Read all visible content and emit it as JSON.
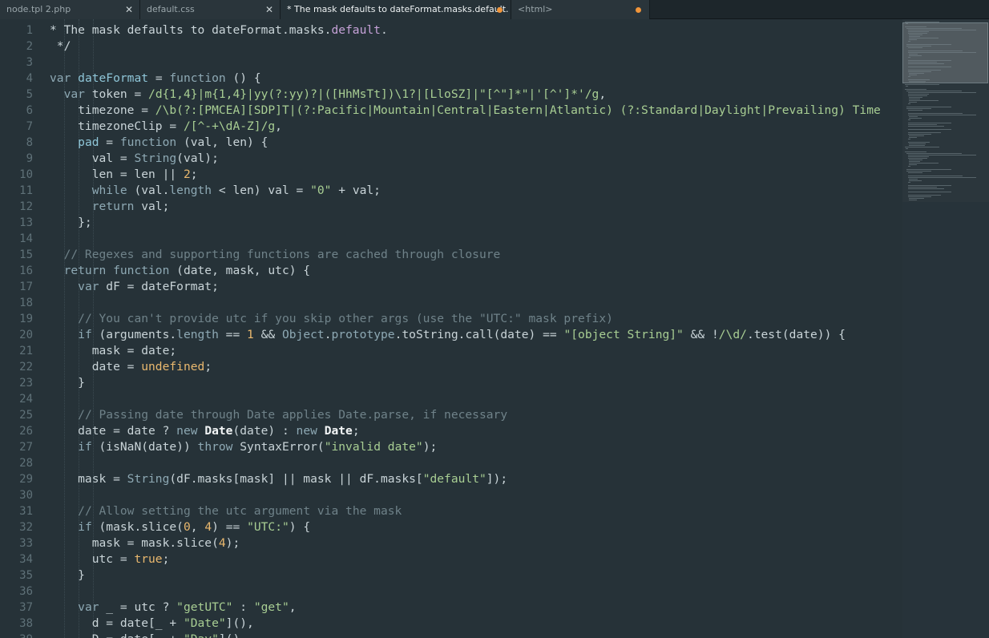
{
  "tabs": [
    {
      "label": "node.tpl 2.php",
      "state": "close"
    },
    {
      "label": "default.css",
      "state": "close"
    },
    {
      "label": "* The mask defaults to dateFormat.masks.default.",
      "state": "modified"
    },
    {
      "label": "<html>",
      "state": "modified"
    }
  ],
  "tab_close_glyph": "✕",
  "active_tab_index": 2,
  "colors": {
    "background": "#263238",
    "modified_dot": "#f0953a",
    "string": "#a8ce93",
    "number": "#e9b86e",
    "comment": "#6f8289",
    "property": "#c6a2d8"
  },
  "line_numbers": [
    "1",
    "2",
    "3",
    "4",
    "5",
    "6",
    "7",
    "8",
    "9",
    "10",
    "11",
    "12",
    "13",
    "14",
    "15",
    "16",
    "17",
    "18",
    "19",
    "20",
    "21",
    "22",
    "23",
    "24",
    "25",
    "26",
    "27",
    "28",
    "29",
    "30",
    "31",
    "32",
    "33",
    "34",
    "35",
    "36",
    "37",
    "38",
    "39"
  ],
  "code_lines": [
    [
      [
        "o",
        "* The mask defaults to dateFormat.masks."
      ],
      [
        "p",
        "default"
      ],
      [
        "o",
        "."
      ]
    ],
    [
      [
        "o",
        " */"
      ]
    ],
    [],
    [
      [
        "k",
        "var "
      ],
      [
        "bi",
        "dateFormat"
      ],
      [
        "o",
        " = "
      ],
      [
        "k",
        "function"
      ],
      [
        "o",
        " () {"
      ]
    ],
    [
      [
        "o",
        "  "
      ],
      [
        "k",
        "var "
      ],
      [
        "o",
        "token = "
      ],
      [
        "s",
        "/d{1,4}|m{1,4}|yy(?:yy)?|([HhMsTt])\\1?|[LloSZ]|\"[^\"]*\"|'[^']*'/g"
      ],
      [
        "o",
        ","
      ]
    ],
    [
      [
        "o",
        "    timezone = "
      ],
      [
        "s",
        "/\\b(?:[PMCEA][SDP]T|(?:Pacific|Mountain|Central|Eastern|Atlantic) (?:Standard|Daylight|Prevailing) Time"
      ]
    ],
    [
      [
        "o",
        "    timezoneClip = "
      ],
      [
        "s",
        "/[^-+\\dA-Z]/g"
      ],
      [
        "o",
        ","
      ]
    ],
    [
      [
        "o",
        "    "
      ],
      [
        "bi",
        "pad"
      ],
      [
        "o",
        " = "
      ],
      [
        "k",
        "function"
      ],
      [
        "o",
        " (val, len) {"
      ]
    ],
    [
      [
        "o",
        "      val = "
      ],
      [
        "f",
        "String"
      ],
      [
        "o",
        "(val);"
      ]
    ],
    [
      [
        "o",
        "      len = len || "
      ],
      [
        "n",
        "2"
      ],
      [
        "o",
        ";"
      ]
    ],
    [
      [
        "o",
        "      "
      ],
      [
        "k",
        "while"
      ],
      [
        "o",
        " (val."
      ],
      [
        "f",
        "length"
      ],
      [
        "o",
        " < len) val = "
      ],
      [
        "s",
        "\"0\""
      ],
      [
        "o",
        " + val;"
      ]
    ],
    [
      [
        "o",
        "      "
      ],
      [
        "k",
        "return"
      ],
      [
        "o",
        " val;"
      ]
    ],
    [
      [
        "o",
        "    };"
      ]
    ],
    [],
    [
      [
        "o",
        "  "
      ],
      [
        "c",
        "// Regexes and supporting functions are cached through closure"
      ]
    ],
    [
      [
        "o",
        "  "
      ],
      [
        "k",
        "return function"
      ],
      [
        "o",
        " (date, mask, utc) {"
      ]
    ],
    [
      [
        "o",
        "    "
      ],
      [
        "k",
        "var"
      ],
      [
        "o",
        " dF = dateFormat;"
      ]
    ],
    [],
    [
      [
        "o",
        "    "
      ],
      [
        "c",
        "// You can't provide utc if you skip other args (use the \"UTC:\" mask prefix)"
      ]
    ],
    [
      [
        "o",
        "    "
      ],
      [
        "k",
        "if"
      ],
      [
        "o",
        " (arguments."
      ],
      [
        "f",
        "length"
      ],
      [
        "o",
        " == "
      ],
      [
        "n",
        "1"
      ],
      [
        "o",
        " && "
      ],
      [
        "f",
        "Object"
      ],
      [
        "o",
        "."
      ],
      [
        "f",
        "prototype"
      ],
      [
        "o",
        ".toString.call(date) == "
      ],
      [
        "s",
        "\"[object String]\""
      ],
      [
        "o",
        " && !"
      ],
      [
        "s",
        "/\\d/"
      ],
      [
        "o",
        ".test(date)) {"
      ]
    ],
    [
      [
        "o",
        "      mask = date;"
      ]
    ],
    [
      [
        "o",
        "      date = "
      ],
      [
        "n",
        "undefined"
      ],
      [
        "o",
        ";"
      ]
    ],
    [
      [
        "o",
        "    }"
      ]
    ],
    [],
    [
      [
        "o",
        "    "
      ],
      [
        "c",
        "// Passing date through Date applies Date.parse, if necessary"
      ]
    ],
    [
      [
        "o",
        "    date = date ? "
      ],
      [
        "k",
        "new "
      ],
      [
        "b",
        "Date"
      ],
      [
        "o",
        "(date) : "
      ],
      [
        "k",
        "new "
      ],
      [
        "b",
        "Date"
      ],
      [
        "o",
        ";"
      ]
    ],
    [
      [
        "o",
        "    "
      ],
      [
        "k",
        "if"
      ],
      [
        "o",
        " (isNaN(date)) "
      ],
      [
        "k",
        "throw"
      ],
      [
        "o",
        " SyntaxError("
      ],
      [
        "s",
        "\"invalid date\""
      ],
      [
        "o",
        ");"
      ]
    ],
    [],
    [
      [
        "o",
        "    mask = "
      ],
      [
        "f",
        "String"
      ],
      [
        "o",
        "(dF.masks[mask] || mask || dF.masks["
      ],
      [
        "s",
        "\"default\""
      ],
      [
        "o",
        "]);"
      ]
    ],
    [],
    [
      [
        "o",
        "    "
      ],
      [
        "c",
        "// Allow setting the utc argument via the mask"
      ]
    ],
    [
      [
        "o",
        "    "
      ],
      [
        "k",
        "if"
      ],
      [
        "o",
        " (mask.slice("
      ],
      [
        "n",
        "0"
      ],
      [
        "o",
        ", "
      ],
      [
        "n",
        "4"
      ],
      [
        "o",
        ") == "
      ],
      [
        "s",
        "\"UTC:\""
      ],
      [
        "o",
        ") {"
      ]
    ],
    [
      [
        "o",
        "      mask = mask.slice("
      ],
      [
        "n",
        "4"
      ],
      [
        "o",
        ");"
      ]
    ],
    [
      [
        "o",
        "      utc = "
      ],
      [
        "n",
        "true"
      ],
      [
        "o",
        ";"
      ]
    ],
    [
      [
        "o",
        "    }"
      ]
    ],
    [],
    [
      [
        "o",
        "    "
      ],
      [
        "k",
        "var"
      ],
      [
        "o",
        " _ = utc ? "
      ],
      [
        "s",
        "\"getUTC\""
      ],
      [
        "o",
        " : "
      ],
      [
        "s",
        "\"get\""
      ],
      [
        "o",
        ","
      ]
    ],
    [
      [
        "o",
        "      d = date[_ + "
      ],
      [
        "s",
        "\"Date\""
      ],
      [
        "o",
        "](),"
      ]
    ],
    [
      [
        "o",
        "      D = date[_ + "
      ],
      [
        "s",
        "\"Day\""
      ],
      [
        "o",
        "](),"
      ]
    ]
  ]
}
